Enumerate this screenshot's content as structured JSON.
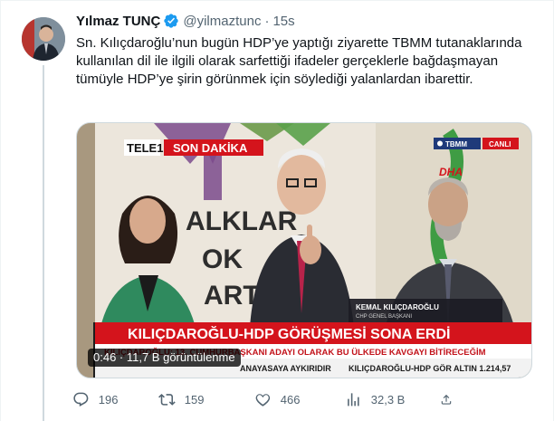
{
  "tweet": {
    "author_name": "Yılmaz TUNÇ",
    "author_handle": "@yilmaztunc",
    "separator": "·",
    "time": "15s",
    "text": "Sn. Kılıçdaroğlu’nun bugün HDP’ye  yaptığı ziyarette TBMM tutanaklarında kullanılan dil ile ilgili olarak sarfettiği ifadeler gerçeklerle bağdaşmayan tümüyle HDP’ye şirin görünmek için söylediği yalanlardan ibarettir."
  },
  "media": {
    "video_badge": "0:46 · 11,7 B görüntülenme",
    "broadcast": {
      "channel": "TELE1",
      "breaking": "SON DAKİKA",
      "location": "TBMM",
      "live": "CANLI",
      "agency": "DHA",
      "background_letters": [
        "ALKLAR",
        "OK",
        "ART"
      ],
      "speaker_name": "KEMAL KILIÇDAROĞLU",
      "speaker_title": "CHP GENEL BAŞKANI",
      "headline": "KILIÇDAROĞLU-HDP GÖRÜŞMESİ SONA ERDİ",
      "subheadline": "KILIÇDAROĞLU: 13. CUMHURBAŞKANI ADAYI OLARAK BU ÜLKEDE KAVGAYI BİTİRECEĞİM",
      "ticker_left": "ANAYASAYA AYKIRIDIR",
      "ticker_right": "KILIÇDAROĞLU-HDP GÖR ALTIN 1.214,57"
    }
  },
  "actions": {
    "replies": "196",
    "retweets": "159",
    "likes": "466",
    "views": "32,3 B"
  },
  "colors": {
    "accent": "#1d9bf0",
    "muted": "#536471",
    "broadcast_red": "#d4141c"
  },
  "icons": [
    "verified-badge-icon",
    "reply-icon",
    "retweet-icon",
    "like-icon",
    "views-icon",
    "share-icon"
  ]
}
